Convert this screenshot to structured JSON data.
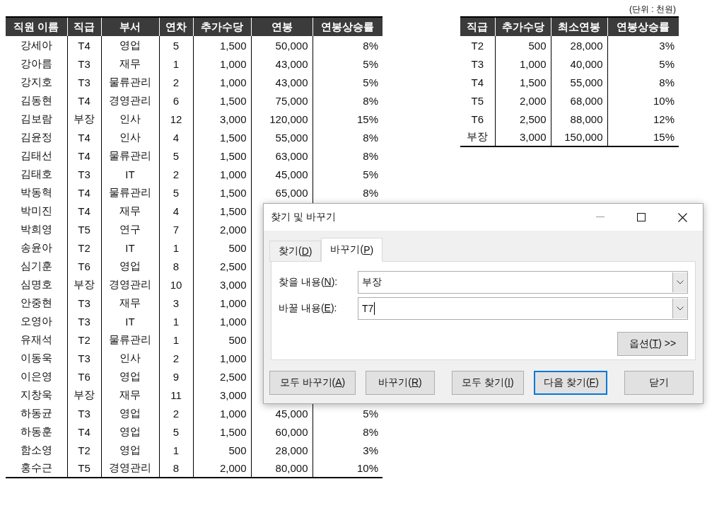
{
  "employee_table": {
    "columns": [
      "직원 이름",
      "직급",
      "부서",
      "연차",
      "추가수당",
      "연봉",
      "연봉상승률"
    ],
    "rows": [
      {
        "cells": [
          "강세아",
          "T4",
          "영업",
          "5",
          "1,500",
          "50,000",
          "8%"
        ]
      },
      {
        "cells": [
          "강아름",
          "T3",
          "재무",
          "1",
          "1,000",
          "43,000",
          "5%"
        ]
      },
      {
        "cells": [
          "강지호",
          "T3",
          "물류관리",
          "2",
          "1,000",
          "43,000",
          "5%"
        ]
      },
      {
        "cells": [
          "김동현",
          "T4",
          "경영관리",
          "6",
          "1,500",
          "75,000",
          "8%"
        ]
      },
      {
        "cells": [
          "김보람",
          "부장",
          "인사",
          "12",
          "3,000",
          "120,000",
          "15%"
        ]
      },
      {
        "cells": [
          "김윤정",
          "T4",
          "인사",
          "4",
          "1,500",
          "55,000",
          "8%"
        ]
      },
      {
        "cells": [
          "김태선",
          "T4",
          "물류관리",
          "5",
          "1,500",
          "63,000",
          "8%"
        ]
      },
      {
        "cells": [
          "김태호",
          "T3",
          "IT",
          "2",
          "1,000",
          "45,000",
          "5%"
        ]
      },
      {
        "cells": [
          "박동혁",
          "T4",
          "물류관리",
          "5",
          "1,500",
          "65,000",
          "8%"
        ]
      },
      {
        "cells": [
          "박미진",
          "T4",
          "재무",
          "4",
          "1,500"
        ]
      },
      {
        "cells": [
          "박희영",
          "T5",
          "연구",
          "7",
          "2,000"
        ]
      },
      {
        "cells": [
          "송윤아",
          "T2",
          "IT",
          "1",
          "500"
        ]
      },
      {
        "cells": [
          "심기훈",
          "T6",
          "영업",
          "8",
          "2,500"
        ]
      },
      {
        "cells": [
          "심명호",
          "부장",
          "경영관리",
          "10",
          "3,000"
        ]
      },
      {
        "cells": [
          "안중현",
          "T3",
          "재무",
          "3",
          "1,000"
        ]
      },
      {
        "cells": [
          "오영아",
          "T3",
          "IT",
          "1",
          "1,000"
        ]
      },
      {
        "cells": [
          "유재석",
          "T2",
          "물류관리",
          "1",
          "500"
        ]
      },
      {
        "cells": [
          "이동욱",
          "T3",
          "인사",
          "2",
          "1,000"
        ]
      },
      {
        "cells": [
          "이은영",
          "T6",
          "영업",
          "9",
          "2,500"
        ]
      },
      {
        "cells": [
          "지창욱",
          "부장",
          "재무",
          "11",
          "3,000"
        ]
      },
      {
        "cells": [
          "하동균",
          "T3",
          "영업",
          "2",
          "1,000",
          "45,000",
          "5%"
        ]
      },
      {
        "cells": [
          "하동훈",
          "T4",
          "영업",
          "5",
          "1,500",
          "60,000",
          "8%"
        ]
      },
      {
        "cells": [
          "함소영",
          "T2",
          "영업",
          "1",
          "500",
          "28,000",
          "3%"
        ]
      },
      {
        "cells": [
          "홍수근",
          "T5",
          "경영관리",
          "8",
          "2,000",
          "80,000",
          "10%"
        ]
      }
    ]
  },
  "grade_table": {
    "unit_note": "(단위 : 천원)",
    "columns": [
      "직급",
      "추가수당",
      "최소연봉",
      "연봉상승률"
    ],
    "rows": [
      {
        "cells": [
          "T2",
          "500",
          "28,000",
          "3%"
        ]
      },
      {
        "cells": [
          "T3",
          "1,000",
          "40,000",
          "5%"
        ]
      },
      {
        "cells": [
          "T4",
          "1,500",
          "55,000",
          "8%"
        ]
      },
      {
        "cells": [
          "T5",
          "2,000",
          "68,000",
          "10%"
        ]
      },
      {
        "cells": [
          "T6",
          "2,500",
          "88,000",
          "12%"
        ]
      },
      {
        "cells": [
          "부장",
          "3,000",
          "150,000",
          "15%"
        ]
      }
    ]
  },
  "dialog": {
    "title": "찾기 및 바꾸기",
    "tabs": [
      {
        "label": "찾기(D)",
        "selected": false
      },
      {
        "label": "바꾸기(P)",
        "selected": true
      }
    ],
    "fields": [
      {
        "label": "찾을 내용(N):",
        "value": "부장",
        "focused": false
      },
      {
        "label": "바꿀 내용(E):",
        "value": "T7",
        "focused": true
      }
    ],
    "options_button": "옵션(T) >>",
    "buttons": [
      {
        "label": "모두 바꾸기(A)",
        "default": false
      },
      {
        "label": "바꾸기(R)",
        "default": false
      },
      {
        "label": "모두 찾기(I)",
        "default": false
      },
      {
        "label": "다음 찾기(F)",
        "default": true
      },
      {
        "label": "닫기",
        "default": false
      }
    ]
  }
}
